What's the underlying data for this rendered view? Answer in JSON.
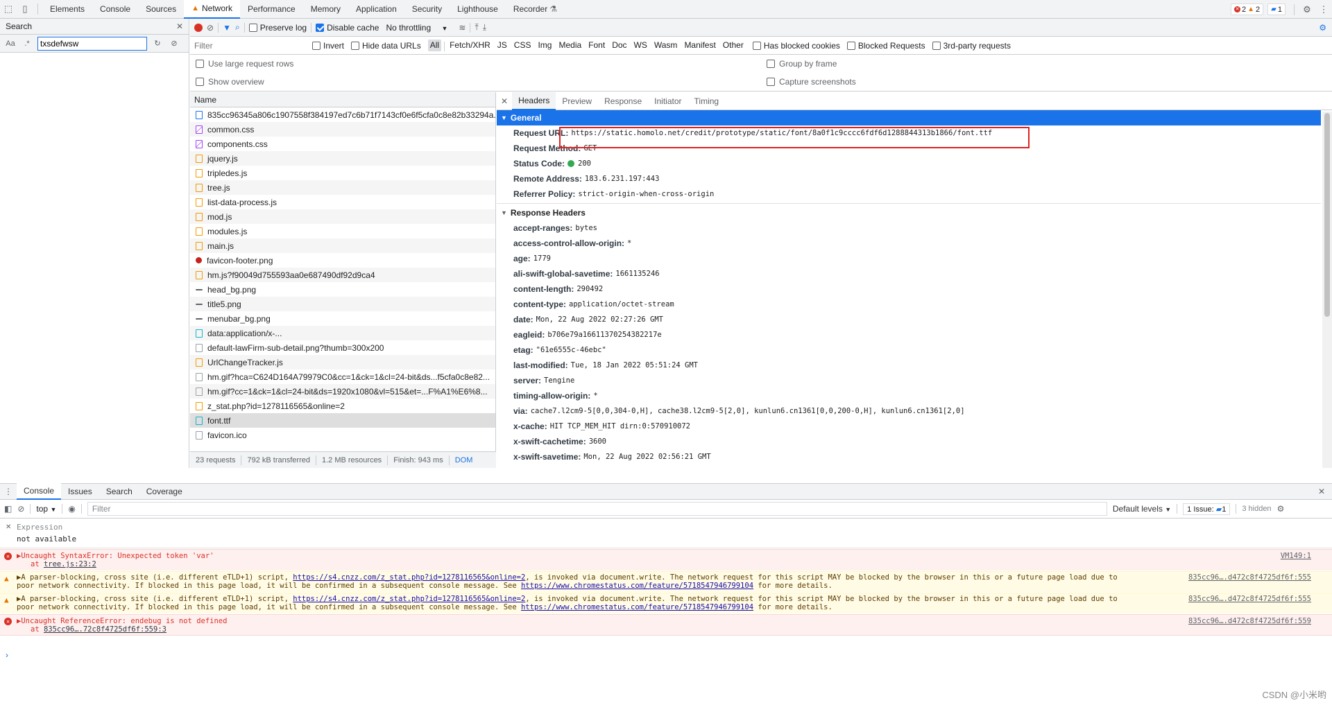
{
  "top_tabs": [
    "Elements",
    "Console",
    "Sources",
    "Network",
    "Performance",
    "Memory",
    "Application",
    "Security",
    "Lighthouse",
    "Recorder"
  ],
  "counters": {
    "errors": "2",
    "warnings": "2",
    "messages": "1"
  },
  "search": {
    "title": "Search",
    "query": "txsdefwsw",
    "case_label": "Aa",
    "regex_label": ".*"
  },
  "network_toolbar": {
    "preserve_log": "Preserve log",
    "disable_cache": "Disable cache",
    "throttling": "No throttling"
  },
  "filter": {
    "placeholder": "Filter",
    "invert": "Invert",
    "hide_data_urls": "Hide data URLs",
    "types": [
      "All",
      "Fetch/XHR",
      "JS",
      "CSS",
      "Img",
      "Media",
      "Font",
      "Doc",
      "WS",
      "Wasm",
      "Manifest",
      "Other"
    ],
    "blocked_cookies": "Has blocked cookies",
    "blocked_requests": "Blocked Requests",
    "third_party": "3rd-party requests"
  },
  "options": {
    "large_rows": "Use large request rows",
    "show_overview": "Show overview",
    "group_by_frame": "Group by frame",
    "capture_screenshots": "Capture screenshots"
  },
  "request_list": {
    "header": "Name",
    "requests": [
      {
        "name": "835cc96345a806c1907558f384197ed7c6b71f7143cf0e6f5cfa0c8e82b33294a...",
        "type": "doc"
      },
      {
        "name": "common.css",
        "type": "css"
      },
      {
        "name": "components.css",
        "type": "css"
      },
      {
        "name": "jquery.js",
        "type": "js"
      },
      {
        "name": "tripledes.js",
        "type": "js"
      },
      {
        "name": "tree.js",
        "type": "js"
      },
      {
        "name": "list-data-process.js",
        "type": "js"
      },
      {
        "name": "mod.js",
        "type": "js"
      },
      {
        "name": "modules.js",
        "type": "js"
      },
      {
        "name": "main.js",
        "type": "js"
      },
      {
        "name": "favicon-footer.png",
        "type": "img"
      },
      {
        "name": "hm.js?f90049d755593aa0e687490df92d9ca4",
        "type": "js"
      },
      {
        "name": "head_bg.png",
        "type": "dash"
      },
      {
        "name": "title5.png",
        "type": "dash"
      },
      {
        "name": "menubar_bg.png",
        "type": "dash"
      },
      {
        "name": "data:application/x-...",
        "type": "font"
      },
      {
        "name": "default-lawFirm-sub-detail.png?thumb=300x200",
        "type": "other"
      },
      {
        "name": "UrlChangeTracker.js",
        "type": "js"
      },
      {
        "name": "hm.gif?hca=C624D164A79979C0&cc=1&ck=1&cl=24-bit&ds...f5cfa0c8e82...",
        "type": "other"
      },
      {
        "name": "hm.gif?cc=1&ck=1&cl=24-bit&ds=1920x1080&vl=515&et=...F%A1%E6%8...",
        "type": "other"
      },
      {
        "name": "z_stat.php?id=1278116565&online=2",
        "type": "js"
      },
      {
        "name": "font.ttf",
        "type": "font"
      },
      {
        "name": "favicon.ico",
        "type": "other"
      }
    ]
  },
  "status": {
    "requests": "23 requests",
    "transferred": "792 kB transferred",
    "resources": "1.2 MB resources",
    "finish": "Finish: 943 ms",
    "dom": "DOM"
  },
  "detail_tabs": [
    "Headers",
    "Preview",
    "Response",
    "Initiator",
    "Timing"
  ],
  "general": {
    "title": "General",
    "rows": [
      {
        "k": "Request URL:",
        "v": "https://static.homolo.net/credit/prototype/static/font/8a0f1c9cccc6fdf6d1288844313b1866/font.ttf"
      },
      {
        "k": "Request Method:",
        "v": "GET"
      },
      {
        "k": "Status Code:",
        "v": "200"
      },
      {
        "k": "Remote Address:",
        "v": "183.6.231.197:443"
      },
      {
        "k": "Referrer Policy:",
        "v": "strict-origin-when-cross-origin"
      }
    ]
  },
  "response_headers": {
    "title": "Response Headers",
    "rows": [
      {
        "k": "accept-ranges:",
        "v": "bytes"
      },
      {
        "k": "access-control-allow-origin:",
        "v": "*"
      },
      {
        "k": "age:",
        "v": "1779"
      },
      {
        "k": "ali-swift-global-savetime:",
        "v": "1661135246"
      },
      {
        "k": "content-length:",
        "v": "290492"
      },
      {
        "k": "content-type:",
        "v": "application/octet-stream"
      },
      {
        "k": "date:",
        "v": "Mon, 22 Aug 2022 02:27:26 GMT"
      },
      {
        "k": "eagleid:",
        "v": "b706e79a16611370254382217e"
      },
      {
        "k": "etag:",
        "v": "\"61e6555c-46ebc\""
      },
      {
        "k": "last-modified:",
        "v": "Tue, 18 Jan 2022 05:51:24 GMT"
      },
      {
        "k": "server:",
        "v": "Tengine"
      },
      {
        "k": "timing-allow-origin:",
        "v": "*"
      },
      {
        "k": "via:",
        "v": "cache7.l2cm9-5[0,0,304-0,H], cache38.l2cm9-5[2,0], kunlun6.cn1361[0,0,200-0,H], kunlun6.cn1361[2,0]"
      },
      {
        "k": "x-cache:",
        "v": "HIT TCP_MEM_HIT dirn:0:570910072"
      },
      {
        "k": "x-swift-cachetime:",
        "v": "3600"
      },
      {
        "k": "x-swift-savetime:",
        "v": "Mon, 22 Aug 2022 02:56:21 GMT"
      }
    ]
  },
  "drawer_tabs": [
    "Console",
    "Issues",
    "Search",
    "Coverage"
  ],
  "console_toolbar": {
    "context": "top",
    "filter": "Filter",
    "levels": "Default levels",
    "issues": "1 Issue:",
    "issues_count": "1",
    "hidden": "3 hidden"
  },
  "expression": {
    "label": "Expression",
    "value": "not available"
  },
  "messages": [
    {
      "level": "error",
      "text": "Uncaught SyntaxError: Unexpected token 'var'",
      "sub": "tree.js:23:2",
      "sub_prefix": "at ",
      "src": "VM149:1"
    },
    {
      "level": "warning",
      "text_a": "A parser-blocking, cross site (i.e. different eTLD+1) script, ",
      "link1": "https://s4.cnzz.com/z_stat.php?id=1278116565&online=2",
      "text_b": ", is invoked via document.write. The network request for this script MAY be blocked by the browser in this or a future page load due to",
      "line2a": "poor network connectivity. If blocked in this page load, it will be confirmed in a subsequent console message. See ",
      "link2": "https://www.chromestatus.com/feature/5718547946799104",
      "line2b": " for more details.",
      "src": "835cc96….d472c8f4725df6f:555"
    },
    {
      "level": "warning",
      "text_a": "A parser-blocking, cross site (i.e. different eTLD+1) script, ",
      "link1": "https://s4.cnzz.com/z_stat.php?id=1278116565&online=2",
      "text_b": ", is invoked via document.write. The network request for this script MAY be blocked by the browser in this or a future page load due to",
      "line2a": "poor network connectivity. If blocked in this page load, it will be confirmed in a subsequent console message. See ",
      "link2": "https://www.chromestatus.com/feature/5718547946799104",
      "line2b": " for more details.",
      "src": "835cc96….d472c8f4725df6f:555"
    },
    {
      "level": "error",
      "text": "Uncaught ReferenceError: endebug is not defined",
      "sub": "835cc96….72c8f4725df6f:559:3",
      "sub_prefix": "at ",
      "src": "835cc96….d472c8f4725df6f:559"
    }
  ],
  "watermark": "CSDN @小米哟"
}
